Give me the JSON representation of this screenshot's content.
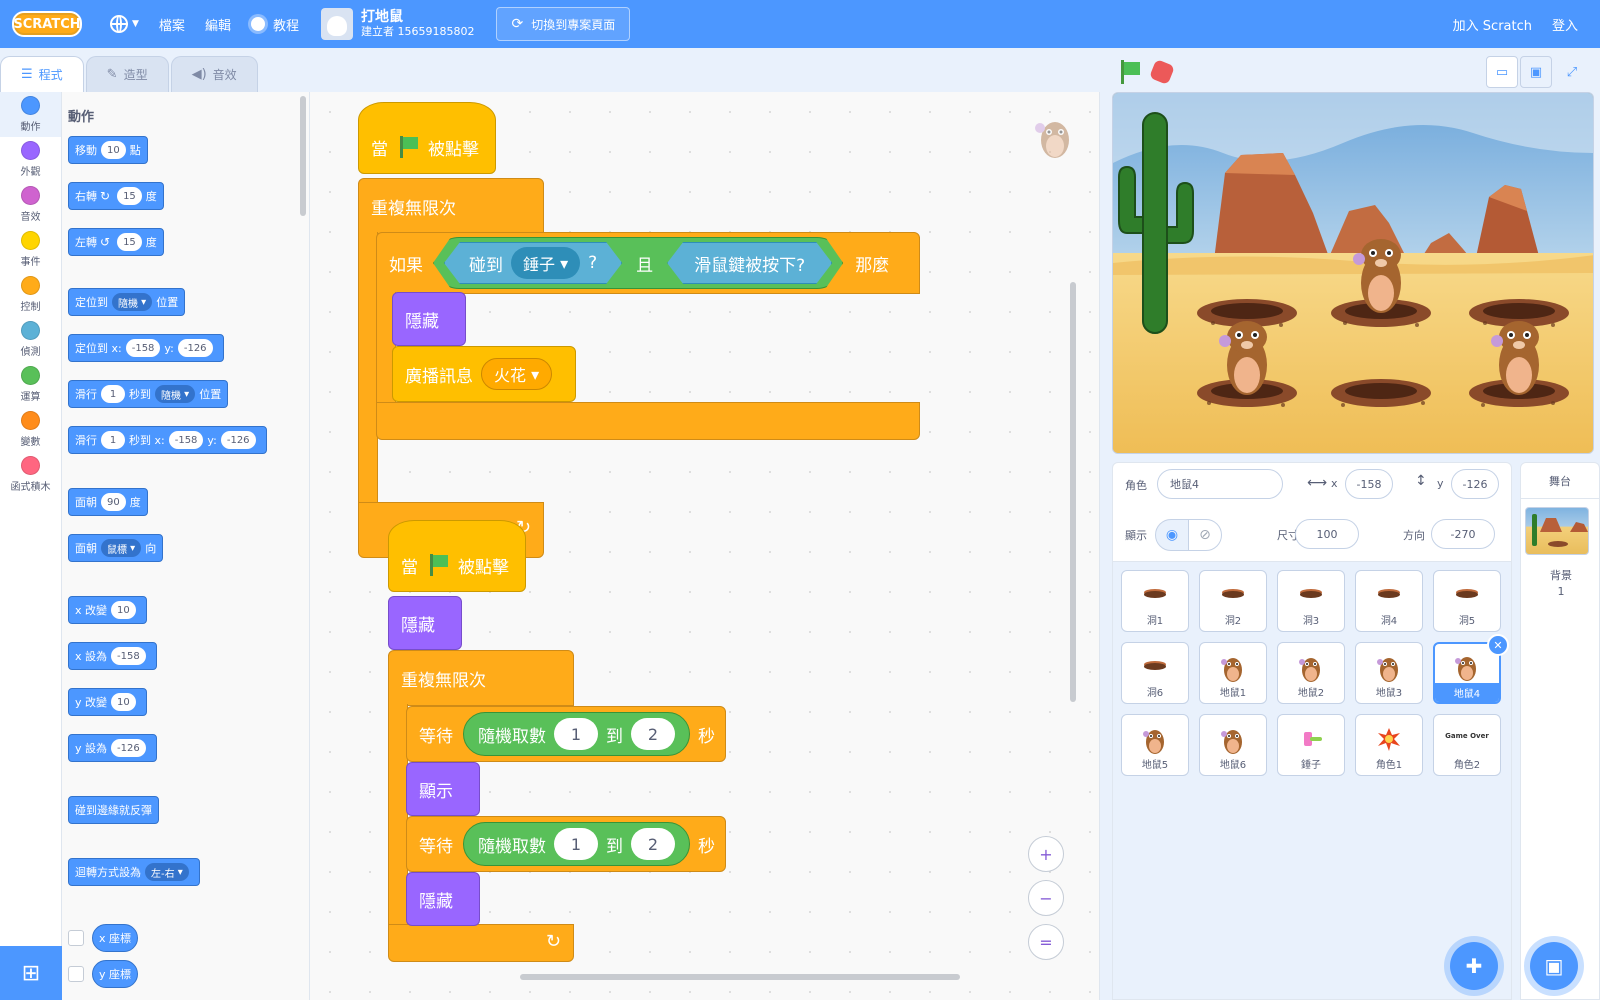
{
  "menubar": {
    "logo": "SCRATCH",
    "file": "檔案",
    "edit": "編輯",
    "tutorials": "教程",
    "project_title": "打地鼠",
    "project_author": "建立者 15659185802",
    "see_project_page": "切換到專案頁面",
    "join": "加入 Scratch",
    "signin": "登入"
  },
  "tabs": {
    "code": "程式",
    "costumes": "造型",
    "sounds": "音效"
  },
  "categories": [
    {
      "label": "動作",
      "color": "#4c97ff"
    },
    {
      "label": "外觀",
      "color": "#9966ff"
    },
    {
      "label": "音效",
      "color": "#cf63cf"
    },
    {
      "label": "事件",
      "color": "#ffd500"
    },
    {
      "label": "控制",
      "color": "#ffab19"
    },
    {
      "label": "偵測",
      "color": "#5cb1d6"
    },
    {
      "label": "運算",
      "color": "#59c059"
    },
    {
      "label": "變數",
      "color": "#ff8c1a"
    },
    {
      "label": "函式積木",
      "color": "#ff6680"
    }
  ],
  "palette": {
    "title": "動作",
    "move": {
      "a": "移動",
      "v": "10",
      "b": "點"
    },
    "turn_right": {
      "a": "右轉",
      "v": "15",
      "b": "度"
    },
    "turn_left": {
      "a": "左轉",
      "v": "15",
      "b": "度"
    },
    "goto": {
      "a": "定位到",
      "dd": "隨機",
      "b": "位置"
    },
    "goto_xy": {
      "a": "定位到 x:",
      "x": "-158",
      "yl": "y:",
      "y": "-126"
    },
    "glide": {
      "a": "滑行",
      "v": "1",
      "b": "秒到",
      "dd": "隨機",
      "c": "位置"
    },
    "glide_xy": {
      "a": "滑行",
      "v": "1",
      "b": "秒到 x:",
      "x": "-158",
      "yl": "y:",
      "y": "-126"
    },
    "point_dir": {
      "a": "面朝",
      "v": "90",
      "b": "度"
    },
    "point_to": {
      "a": "面朝",
      "dd": "鼠標",
      "b": "向"
    },
    "change_x": {
      "a": "x 改變",
      "v": "10"
    },
    "set_x": {
      "a": "x 設為",
      "v": "-158"
    },
    "change_y": {
      "a": "y 改變",
      "v": "10"
    },
    "set_y": {
      "a": "y 設為",
      "v": "-126"
    },
    "bounce": "碰到邊緣就反彈",
    "rotation_style": {
      "a": "迴轉方式設為",
      "dd": "左-右"
    },
    "x_pos": "x 座標",
    "y_pos": "y 座標"
  },
  "script1": {
    "when_flag_a": "當",
    "when_flag_b": "被點擊",
    "forever": "重複無限次",
    "if": "如果",
    "touching": "碰到",
    "touching_dd": "錘子",
    "q": "?",
    "and": "且",
    "mouse_down": "滑鼠鍵被按下?",
    "then": "那麼",
    "hide": "隱藏",
    "broadcast": "廣播訊息",
    "broadcast_dd": "火花"
  },
  "script2": {
    "when_flag_a": "當",
    "when_flag_b": "被點擊",
    "hide": "隱藏",
    "forever": "重複無限次",
    "wait": "等待",
    "random": "隨機取數",
    "from": "1",
    "to_label": "到",
    "to": "2",
    "sec": "秒",
    "show": "顯示",
    "wait2": "等待",
    "random2": "隨機取數",
    "from2": "1",
    "to_label2": "到",
    "to2": "2",
    "sec2": "秒",
    "hide2": "隱藏"
  },
  "zoom": {
    "in": "+",
    "out": "−",
    "reset": "="
  },
  "sprite_info": {
    "sprite_label": "角色",
    "sprite_name": "地鼠4",
    "x_label": "x",
    "x": "-158",
    "y_label": "y",
    "y": "-126",
    "show_label": "顯示",
    "size_label": "尺寸",
    "size": "100",
    "direction_label": "方向",
    "direction": "-270"
  },
  "sprites": [
    {
      "name": "洞1",
      "kind": "hole"
    },
    {
      "name": "洞2",
      "kind": "hole"
    },
    {
      "name": "洞3",
      "kind": "hole"
    },
    {
      "name": "洞4",
      "kind": "hole"
    },
    {
      "name": "洞5",
      "kind": "hole"
    },
    {
      "name": "洞6",
      "kind": "hole"
    },
    {
      "name": "地鼠1",
      "kind": "mole"
    },
    {
      "name": "地鼠2",
      "kind": "mole"
    },
    {
      "name": "地鼠3",
      "kind": "mole"
    },
    {
      "name": "地鼠4",
      "kind": "mole",
      "selected": true
    },
    {
      "name": "地鼠5",
      "kind": "mole"
    },
    {
      "name": "地鼠6",
      "kind": "mole"
    },
    {
      "name": "錘子",
      "kind": "hammer"
    },
    {
      "name": "角色1",
      "kind": "spark"
    },
    {
      "name": "角色2",
      "kind": "gameover",
      "thumb_text": "Game Over"
    }
  ],
  "stage_pane": {
    "title": "舞台",
    "backdrops_label": "背景",
    "backdrops_count": "1"
  }
}
